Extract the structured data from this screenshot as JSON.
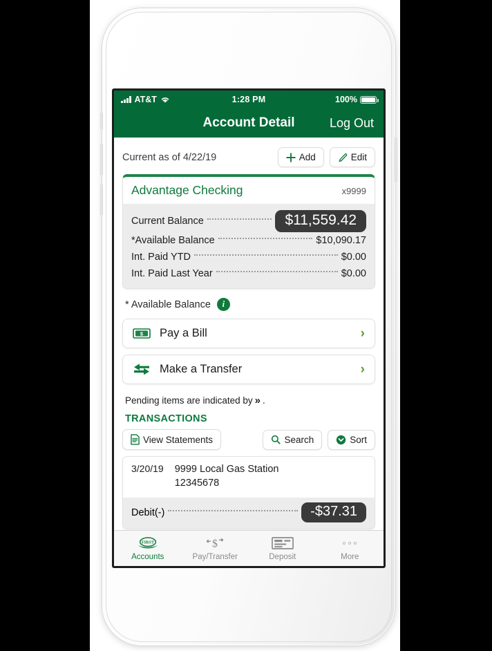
{
  "status_bar": {
    "carrier": "AT&T",
    "signal_icon": "signal-bars-icon",
    "wifi_icon": "wifi-icon",
    "time": "1:28 PM",
    "battery_percent": "100%",
    "battery_icon": "battery-full-icon"
  },
  "nav": {
    "title": "Account Detail",
    "right_action": "Log Out"
  },
  "header": {
    "as_of": "Current as of 4/22/19",
    "add_label": "Add",
    "add_icon": "plus-icon",
    "edit_label": "Edit",
    "edit_icon": "pencil-icon"
  },
  "account": {
    "name": "Advantage Checking",
    "masked_number": "x9999",
    "rows": [
      {
        "label": "Current Balance",
        "value": "$11,559.42",
        "highlight": true
      },
      {
        "label": "*Available Balance",
        "value": "$10,090.17",
        "highlight": false
      },
      {
        "label": "Int. Paid YTD",
        "value": "$0.00",
        "highlight": false
      },
      {
        "label": "Int. Paid Last Year",
        "value": "$0.00",
        "highlight": false
      }
    ]
  },
  "available_note": {
    "text": "* Available Balance",
    "info_icon": "info-icon",
    "info_glyph": "i"
  },
  "actions": [
    {
      "label": "Pay a Bill",
      "icon": "dollar-bill-icon",
      "chevron": "›"
    },
    {
      "label": "Make a Transfer",
      "icon": "transfer-arrows-icon",
      "chevron": "›"
    }
  ],
  "pending_note": {
    "text_before": "Pending items are indicated by",
    "symbol": "»",
    "text_after": "."
  },
  "transactions_section": {
    "title": "TRANSACTIONS",
    "view_statements_label": "View Statements",
    "view_statements_icon": "document-icon",
    "search_label": "Search",
    "search_icon": "search-icon",
    "sort_label": "Sort",
    "sort_icon": "sort-chevron-icon"
  },
  "transaction": {
    "date": "3/20/19",
    "description_line1": "9999 Local Gas Station",
    "description_line2": "12345678",
    "amount_label": "Debit(-)",
    "amount": "-$37.31"
  },
  "tab_bar": [
    {
      "label": "Accounts",
      "icon": "first-bank-logo-icon",
      "active": true
    },
    {
      "label": "Pay/Transfer",
      "icon": "dollar-transfer-icon",
      "active": false
    },
    {
      "label": "Deposit",
      "icon": "check-deposit-icon",
      "active": false
    },
    {
      "label": "More",
      "icon": "more-dots-icon",
      "active": false
    }
  ],
  "colors": {
    "brand_green": "#046A38",
    "accent_green": "#0E7A3C",
    "chip_dark": "#3a3a3a",
    "chevron_green": "#5a9e36"
  }
}
